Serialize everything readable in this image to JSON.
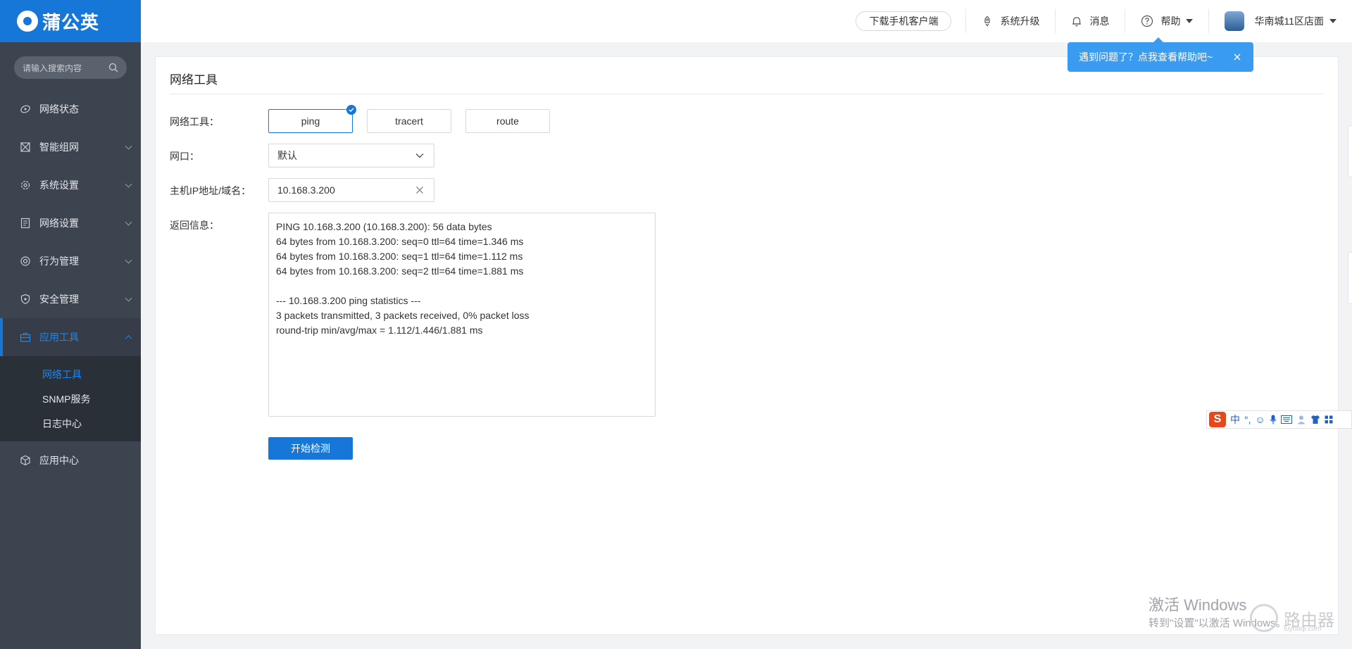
{
  "app": {
    "brand": "蒲公英",
    "accent_color": "#1677d9"
  },
  "sidebar": {
    "search_placeholder": "请输入搜索内容",
    "items": [
      {
        "label": "网络状态",
        "icon": "network-status-icon"
      },
      {
        "label": "智能组网",
        "icon": "smart-networking-icon"
      },
      {
        "label": "系统设置",
        "icon": "gear-icon"
      },
      {
        "label": "网络设置",
        "icon": "network-settings-icon"
      },
      {
        "label": "行为管理",
        "icon": "behavior-icon"
      },
      {
        "label": "安全管理",
        "icon": "shield-icon"
      },
      {
        "label": "应用工具",
        "icon": "toolbox-icon"
      },
      {
        "label": "应用中心",
        "icon": "cube-icon"
      }
    ],
    "sub_items": [
      "网络工具",
      "SNMP服务",
      "日志中心"
    ]
  },
  "header": {
    "download_label": "下载手机客户端",
    "upgrade_label": "系统升级",
    "messages_label": "消息",
    "help_label": "帮助",
    "store_name": "华南城11区店面"
  },
  "tooltip": {
    "text": "遇到问题了？点我查看帮助吧~"
  },
  "panel": {
    "title": "网络工具",
    "tool_label": "网络工具：",
    "tools": [
      "ping",
      "tracert",
      "route"
    ],
    "selected_tool": "ping",
    "port_label": "网口：",
    "port_value": "默认",
    "host_label": "主机IP地址/域名：",
    "host_value": "10.168.3.200",
    "result_label": "返回信息：",
    "result_lines": [
      "PING 10.168.3.200 (10.168.3.200): 56 data bytes",
      "64 bytes from 10.168.3.200: seq=0 ttl=64 time=1.346 ms",
      "64 bytes from 10.168.3.200: seq=1 ttl=64 time=1.112 ms",
      "64 bytes from 10.168.3.200: seq=2 ttl=64 time=1.881 ms",
      "",
      "--- 10.168.3.200 ping statistics ---",
      "3 packets transmitted, 3 packets received, 0% packet loss",
      "round-trip min/avg/max = 1.112/1.446/1.881 ms"
    ],
    "start_label": "开始检测"
  },
  "ime": {
    "logo": "S",
    "mode": "中"
  },
  "watermark": {
    "line1": "激活 Windows",
    "line2": "转到\"设置\"以激活 Windows。",
    "brand": "路由器",
    "brand_sub": "luyouqi.com"
  }
}
